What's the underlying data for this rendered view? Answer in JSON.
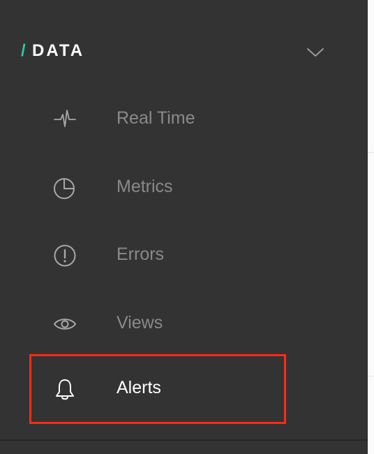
{
  "section": {
    "slash": "/",
    "title": "DATA",
    "accent_color": "#2fc6a3",
    "toggle_icon": "chevron-down-icon"
  },
  "nav": {
    "items": [
      {
        "label": "Real Time",
        "icon": "pulse-icon",
        "active": false
      },
      {
        "label": "Metrics",
        "icon": "pie-chart-icon",
        "active": false
      },
      {
        "label": "Errors",
        "icon": "alert-circle-icon",
        "active": false
      },
      {
        "label": "Views",
        "icon": "eye-icon",
        "active": false
      },
      {
        "label": "Alerts",
        "icon": "bell-icon",
        "active": true,
        "highlighted": true
      }
    ]
  },
  "colors": {
    "panel_background": "#333333",
    "inactive_text": "#8a8a8a",
    "active_text": "#ffffff",
    "highlight_border": "#ff2a17"
  }
}
